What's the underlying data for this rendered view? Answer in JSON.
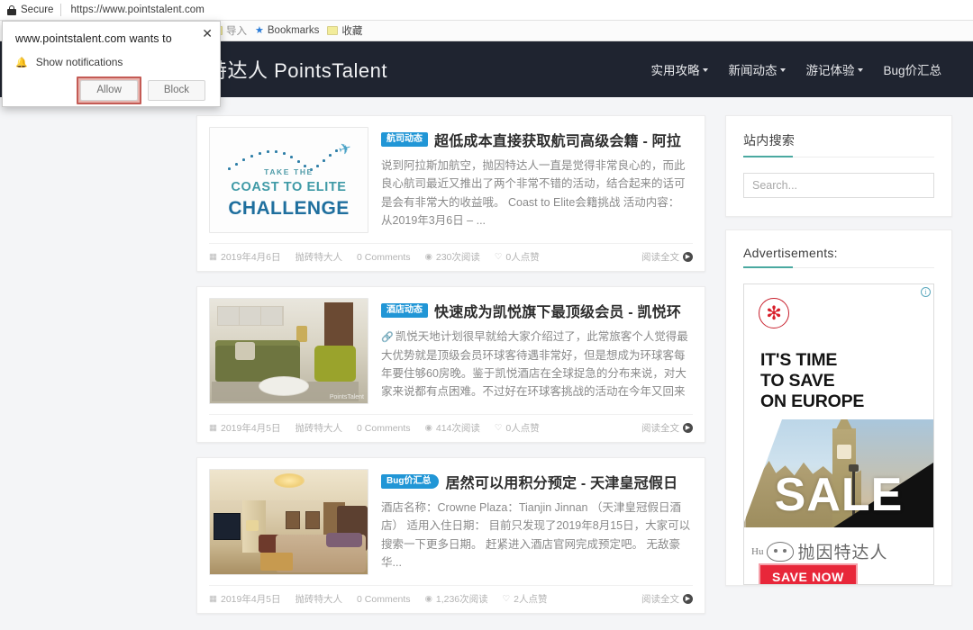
{
  "browser": {
    "security_label": "Secure",
    "lock_icon": "lock-icon",
    "url": "https://www.pointstalent.com",
    "bookmarks": [
      {
        "icon": "folder-icon",
        "label": "导入"
      },
      {
        "icon": "star-icon",
        "label": "Bookmarks"
      },
      {
        "icon": "folder-icon",
        "label": "收藏"
      }
    ]
  },
  "notification_popup": {
    "close_icon": "close-icon",
    "heading": "www.pointstalent.com wants to",
    "permission_icon": "bell-icon",
    "permission_label": "Show notifications",
    "allow_label": "Allow",
    "block_label": "Block",
    "highlight_color": "#c45b55"
  },
  "site": {
    "title": "抛因特达人 PointsTalent",
    "header_bg": "#1f2430",
    "accent_color": "#4aa9a0",
    "nav": [
      {
        "label": "实用攻略",
        "has_dropdown": true
      },
      {
        "label": "新闻动态",
        "has_dropdown": true
      },
      {
        "label": "游记体验",
        "has_dropdown": true
      },
      {
        "label": "Bug价汇总",
        "has_dropdown": false
      }
    ]
  },
  "articles": [
    {
      "category": "航司动态",
      "category_color": "#2196d6",
      "title": "超低成本直接获取航司高级会籍 - 阿拉",
      "excerpt": "说到阿拉斯加航空，抛因特达人一直是觉得非常良心的，而此良心航司最近又推出了两个非常不错的活动，结合起来的话可是会有非常大的收益哦。 Coast to Elite会籍挑战 活动内容： 从2019年3月6日 – ...",
      "date": "2019年4月6日",
      "author": "抛砖特大人",
      "comments": "0 Comments",
      "views": "230次阅读",
      "likes": "0人点赞",
      "read_more": "阅读全文",
      "thumbnail": {
        "kind": "coast-to-elite-banner",
        "line1": "TAKE THE",
        "line2": "COAST TO ELITE",
        "line3": "CHALLENGE"
      }
    },
    {
      "category": "酒店动态",
      "category_color": "#2196d6",
      "title": "快速成为凯悦旗下最顶级会员 - 凯悦环",
      "excerpt": "凯悦天地计划很早就给大家介绍过了，此常旅客个人觉得最大优势就是顶级会员环球客待遇非常好，但是想成为环球客每年要住够60房晚。鉴于凯悦酒店在全球捉急的分布来说，对大家来说都有点困难。不过好在环球客挑战的活动在今年又回来了...",
      "date": "2019年4月5日",
      "author": "抛砖特大人",
      "comments": "0 Comments",
      "views": "414次阅读",
      "likes": "0人点赞",
      "read_more": "阅读全文",
      "thumbnail": {
        "kind": "hotel-lounge-photo"
      }
    },
    {
      "category": "Bug价汇总",
      "category_color": "#2196d6",
      "title": "居然可以用积分预定 - 天津皇冠假日",
      "excerpt": "酒店名称：Crowne Plaza：Tianjin Jinnan （天津皇冠假日酒店） 适用入住日期： 目前只发现了2019年8月15日，大家可以搜索一下更多日期。 赶紧进入酒店官网完成预定吧。 无敌豪华...",
      "date": "2019年4月5日",
      "author": "抛砖特大人",
      "comments": "0 Comments",
      "views": "1,236次阅读",
      "likes": "2人点赞",
      "read_more": "阅读全文",
      "thumbnail": {
        "kind": "hotel-suite-photo"
      }
    }
  ],
  "sidebar": {
    "search_widget": {
      "title": "站内搜索",
      "placeholder": "Search..."
    },
    "ads_widget": {
      "title": "Advertisements:",
      "adchoices_icon": "info-icon",
      "ad": {
        "brand_logo": "maple-leaf-icon",
        "headline_line1": "IT'S TIME",
        "headline_line2": "TO SAVE",
        "headline_line3": "ON EUROPE",
        "sale_text": "SALE",
        "cta_label": "SAVE NOW",
        "cta_color": "#e8273a",
        "watermark_prefix": "Hu",
        "watermark_text": "抛因特达人"
      }
    }
  },
  "meta_icons": {
    "calendar": "calendar-icon",
    "views": "eye-icon",
    "likes": "thumbs-up-icon",
    "arrow": "arrow-right-icon"
  }
}
